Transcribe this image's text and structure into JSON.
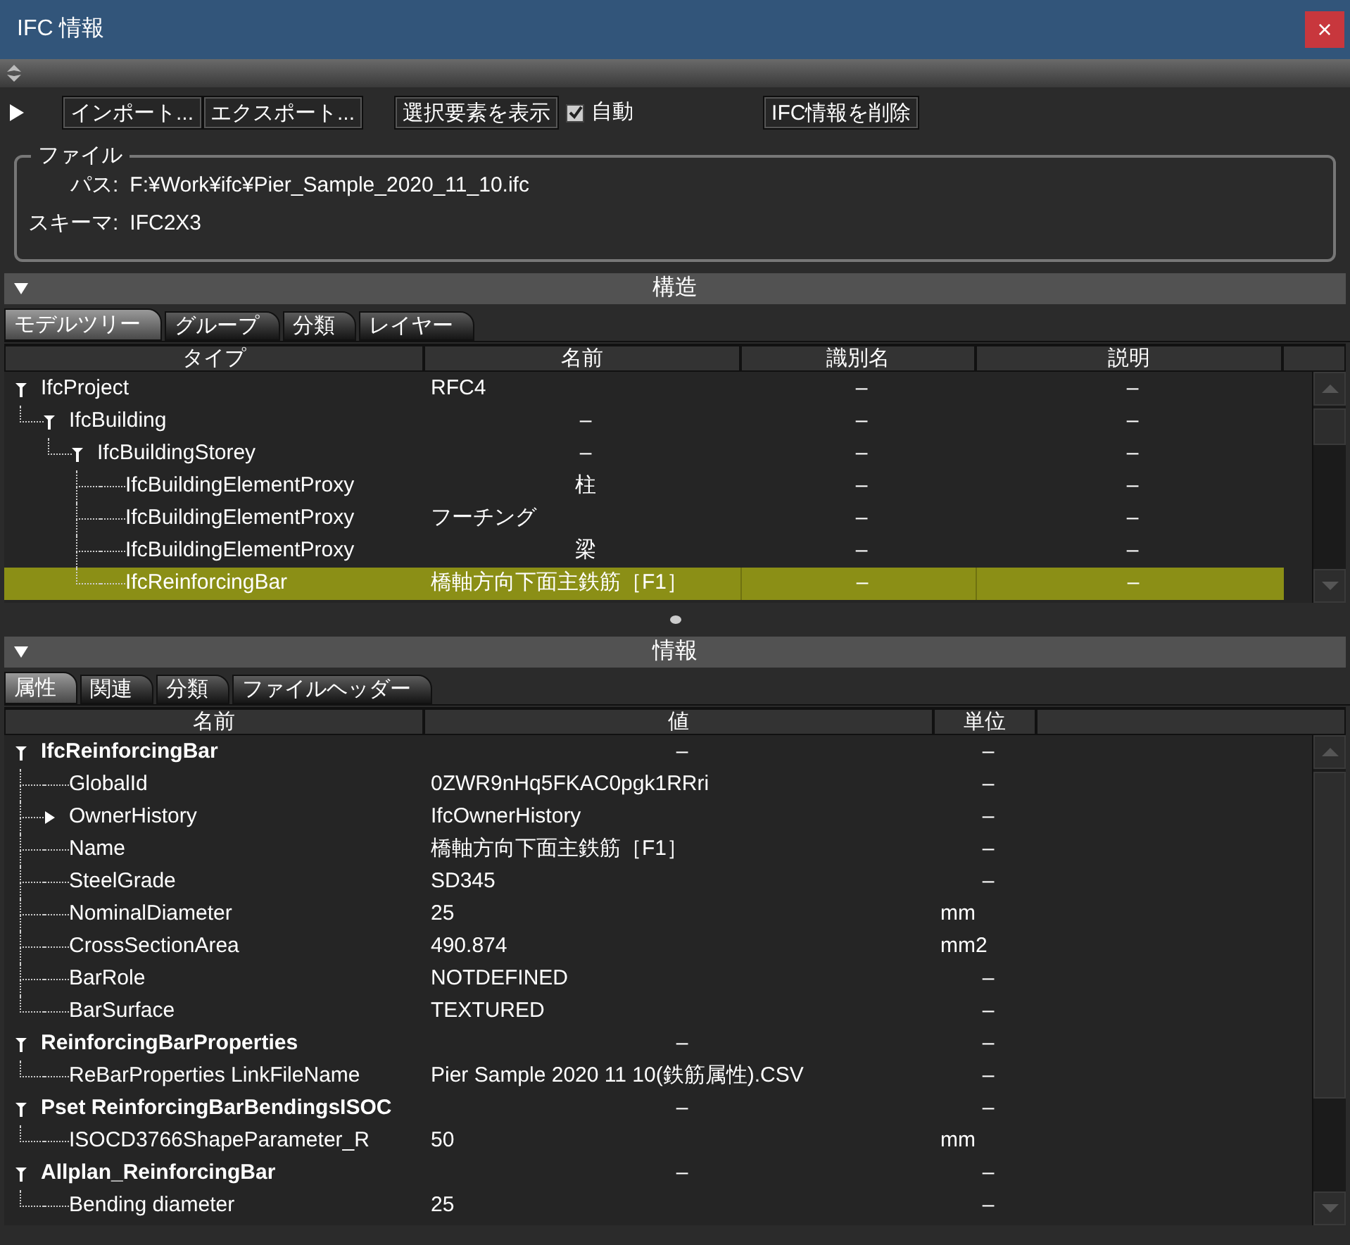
{
  "window": {
    "title": "IFC 情報",
    "close": "×"
  },
  "toolbar": {
    "buttons": [
      {
        "label": "インポート..."
      },
      {
        "label": "エクスポート..."
      }
    ],
    "show_button": {
      "label": "選択要素を表示"
    },
    "auto": {
      "label": "自動",
      "checked": true
    },
    "delete_button": {
      "label": "IFC情報を削除"
    }
  },
  "file": {
    "legend": "ファイル",
    "fields": [
      {
        "label": "パス:",
        "value": "F:¥Work¥ifc¥Pier_Sample_2020_11_10.ifc"
      },
      {
        "label": "スキーマ:",
        "value": "IFC2X3"
      }
    ]
  },
  "structure": {
    "title": "構造",
    "expanded": true,
    "tabs": [
      {
        "label": "モデルツリー",
        "selected": true
      },
      {
        "label": "グループ",
        "selected": false
      },
      {
        "label": "分類",
        "selected": false
      },
      {
        "label": "レイヤー",
        "selected": false
      }
    ],
    "columns": [
      "タイプ",
      "名前",
      "識別名",
      "説明"
    ],
    "rows": [
      {
        "cells": [
          "IfcProject",
          "RFC4",
          "–",
          "–"
        ],
        "expanded": true,
        "selected": false,
        "children": [
          {
            "cells": [
              "IfcBuilding",
              "–",
              "–",
              "–"
            ],
            "expanded": true,
            "selected": false,
            "children": [
              {
                "cells": [
                  "IfcBuildingStorey",
                  "–",
                  "–",
                  "–"
                ],
                "expanded": true,
                "selected": false,
                "children": [
                  {
                    "cells": [
                      "IfcBuildingElementProxy",
                      "柱",
                      "–",
                      "–"
                    ],
                    "selected": false
                  },
                  {
                    "cells": [
                      "IfcBuildingElementProxy",
                      "フーチング",
                      "–",
                      "–"
                    ],
                    "selected": false
                  },
                  {
                    "cells": [
                      "IfcBuildingElementProxy",
                      "梁",
                      "–",
                      "–"
                    ],
                    "selected": false
                  },
                  {
                    "cells": [
                      "IfcReinforcingBar",
                      "橋軸方向下面主鉄筋［F1］",
                      "–",
                      "–"
                    ],
                    "selected": true
                  }
                ]
              }
            ]
          }
        ]
      }
    ]
  },
  "info": {
    "title": "情報",
    "expanded": true,
    "tabs": [
      {
        "label": "属性",
        "selected": true
      },
      {
        "label": "関連",
        "selected": false
      },
      {
        "label": "分類",
        "selected": false
      },
      {
        "label": "ファイルヘッダー",
        "selected": false
      }
    ],
    "columns": [
      "名前",
      "値",
      "単位"
    ],
    "rows": [
      {
        "cells": [
          "IfcReinforcingBar",
          "–",
          "–"
        ],
        "expanded": true,
        "children": [
          {
            "cells": [
              "GlobalId",
              "0ZWR9nHq5FKAC0pgk1RRri",
              "–"
            ]
          },
          {
            "cells": [
              "OwnerHistory",
              "IfcOwnerHistory",
              "–"
            ],
            "expanded": false
          },
          {
            "cells": [
              "Name",
              "橋軸方向下面主鉄筋［F1］",
              "–"
            ]
          },
          {
            "cells": [
              "SteelGrade",
              "SD345",
              "–"
            ]
          },
          {
            "cells": [
              "NominalDiameter",
              "25",
              "mm"
            ]
          },
          {
            "cells": [
              "CrossSectionArea",
              "490.874",
              "mm2"
            ]
          },
          {
            "cells": [
              "BarRole",
              "NOTDEFINED",
              "–"
            ]
          },
          {
            "cells": [
              "BarSurface",
              "TEXTURED",
              "–"
            ]
          }
        ]
      },
      {
        "cells": [
          "ReinforcingBarProperties",
          "–",
          "–"
        ],
        "expanded": true,
        "children": [
          {
            "cells": [
              "ReBarProperties LinkFileName",
              "Pier Sample 2020 11 10(鉄筋属性).CSV",
              "–"
            ]
          }
        ]
      },
      {
        "cells": [
          "Pset ReinforcingBarBendingsISOC",
          "–",
          "–"
        ],
        "expanded": true,
        "children": [
          {
            "cells": [
              "ISOCD3766ShapeParameter_R",
              "50",
              "mm"
            ]
          }
        ]
      },
      {
        "cells": [
          "Allplan_ReinforcingBar",
          "–",
          "–"
        ],
        "expanded": true,
        "children": [
          {
            "cells": [
              "Bending diameter",
              "25",
              "–"
            ]
          }
        ]
      }
    ]
  }
}
